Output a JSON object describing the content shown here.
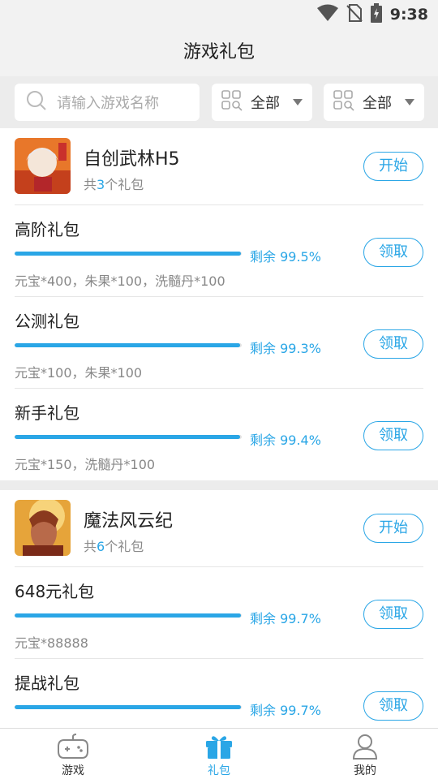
{
  "status": {
    "time": "9:38"
  },
  "title": "游戏礼包",
  "filters": {
    "search_placeholder": "请输入游戏名称",
    "drop1": "全部",
    "drop2": "全部"
  },
  "games": [
    {
      "name": "自创武林H5",
      "count_prefix": "共",
      "count": "3",
      "count_suffix": "个礼包",
      "action": "开始",
      "gifts": [
        {
          "name": "高阶礼包",
          "remaining_label": "剩余 99.5%",
          "remaining_pct": 99.5,
          "content": "元宝*400，朱果*100，洗髓丹*100",
          "action": "领取"
        },
        {
          "name": "公测礼包",
          "remaining_label": "剩余 99.3%",
          "remaining_pct": 99.3,
          "content": "元宝*100，朱果*100",
          "action": "领取"
        },
        {
          "name": "新手礼包",
          "remaining_label": "剩余 99.4%",
          "remaining_pct": 99.4,
          "content": "元宝*150，洗髓丹*100",
          "action": "领取"
        }
      ]
    },
    {
      "name": "魔法风云纪",
      "count_prefix": "共",
      "count": "6",
      "count_suffix": "个礼包",
      "action": "开始",
      "gifts": [
        {
          "name": "648元礼包",
          "remaining_label": "剩余 99.7%",
          "remaining_pct": 99.7,
          "content": "元宝*88888",
          "action": "领取"
        },
        {
          "name": "提战礼包",
          "remaining_label": "剩余 99.7%",
          "remaining_pct": 99.7,
          "content": "",
          "action": "领取"
        }
      ]
    }
  ],
  "nav": [
    {
      "label": "游戏",
      "icon": "gamepad-icon",
      "active": false
    },
    {
      "label": "礼包",
      "icon": "gift-icon",
      "active": true
    },
    {
      "label": "我的",
      "icon": "user-icon",
      "active": false
    }
  ],
  "colors": {
    "accent": "#2aa6e6"
  }
}
